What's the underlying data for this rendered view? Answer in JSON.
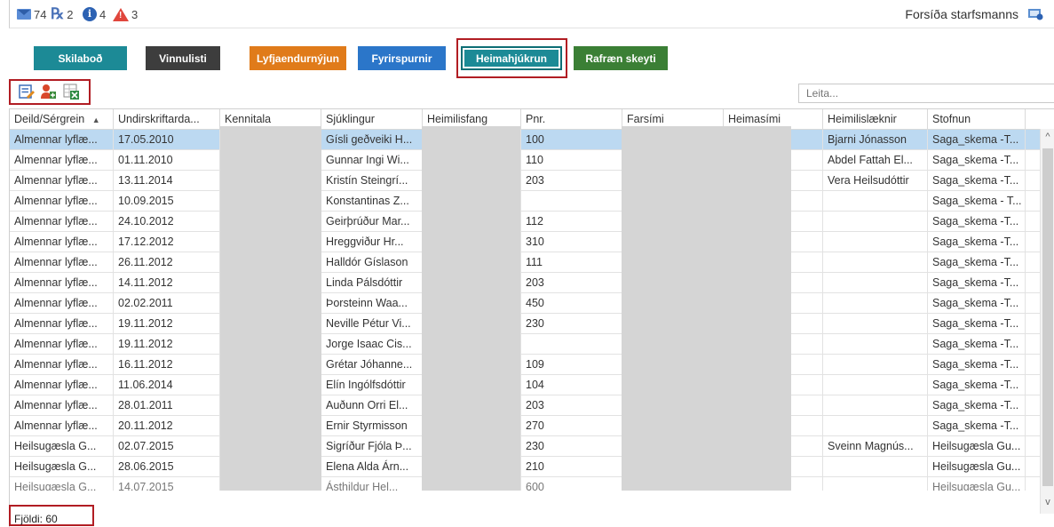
{
  "counters": [
    {
      "icon": "mail-icon",
      "value": "74"
    },
    {
      "icon": "prescription-icon",
      "value": "2"
    },
    {
      "icon": "info-icon",
      "value": "4"
    },
    {
      "icon": "warning-icon",
      "value": "3"
    }
  ],
  "header": {
    "home_link": "Forsíða starfsmanns"
  },
  "modules": [
    {
      "label": "Skilaboð",
      "color": "#1c8a96"
    },
    {
      "label": "Vinnulisti",
      "color": "#3d3d3d"
    },
    {
      "label": "Lyfjaendurnýjun",
      "color": "#e07b1a"
    },
    {
      "label": "Fyrirspurnir",
      "color": "#2b76c9"
    },
    {
      "label": "Heimahjúkrun",
      "color": "#1c8a96"
    },
    {
      "label": "Rafræn skeyti",
      "color": "#3b7f35"
    }
  ],
  "search": {
    "placeholder": "Leita..."
  },
  "table": {
    "columns": [
      "Deild/Sérgrein",
      "Undirskriftarda...",
      "Kennitala",
      "Sjúklingur",
      "Heimilisfang",
      "Pnr.",
      "Farsími",
      "Heimasími",
      "Heimilislæknir",
      "Stofnun"
    ],
    "sort_indicator": "▲",
    "rows": [
      [
        "Almennar lyflæ...",
        "17.05.2010",
        "",
        "Gísli geðveiki H...",
        "",
        "100",
        "",
        "",
        "Bjarni Jónasson",
        "Saga_skema -T..."
      ],
      [
        "Almennar lyflæ...",
        "01.11.2010",
        "",
        "Gunnar Ingi Wi...",
        "",
        "110",
        "",
        "",
        "Abdel Fattah El...",
        "Saga_skema -T..."
      ],
      [
        "Almennar lyflæ...",
        "13.11.2014",
        "",
        "Kristín Steingrí...",
        "",
        "203",
        "",
        "",
        "Vera Heilsudóttir",
        "Saga_skema -T..."
      ],
      [
        "Almennar lyflæ...",
        "10.09.2015",
        "",
        "Konstantinas Z...",
        "",
        "",
        "",
        "",
        "",
        "Saga_skema - T..."
      ],
      [
        "Almennar lyflæ...",
        "24.10.2012",
        "",
        "Geirþrúður Mar...",
        "",
        "112",
        "",
        "",
        "",
        "Saga_skema -T..."
      ],
      [
        "Almennar lyflæ...",
        "17.12.2012",
        "",
        "Hreggviður Hr...",
        "",
        "310",
        "",
        "",
        "",
        "Saga_skema -T..."
      ],
      [
        "Almennar lyflæ...",
        "26.11.2012",
        "",
        "Halldór Gíslason",
        "",
        "111",
        "",
        "",
        "",
        "Saga_skema -T..."
      ],
      [
        "Almennar lyflæ...",
        "14.11.2012",
        "",
        "Linda Pálsdóttir",
        "",
        "203",
        "",
        "",
        "",
        "Saga_skema -T..."
      ],
      [
        "Almennar lyflæ...",
        "02.02.2011",
        "",
        "Þorsteinn Waa...",
        "",
        "450",
        "",
        "",
        "",
        "Saga_skema -T..."
      ],
      [
        "Almennar lyflæ...",
        "19.11.2012",
        "",
        "Neville Pétur Vi...",
        "",
        "230",
        "",
        "",
        "",
        "Saga_skema -T..."
      ],
      [
        "Almennar lyflæ...",
        "19.11.2012",
        "",
        "Jorge Isaac Cis...",
        "",
        "",
        "",
        "",
        "",
        "Saga_skema -T..."
      ],
      [
        "Almennar lyflæ...",
        "16.11.2012",
        "",
        "Grétar Jóhanne...",
        "",
        "109",
        "",
        "",
        "",
        "Saga_skema -T..."
      ],
      [
        "Almennar lyflæ...",
        "11.06.2014",
        "",
        "Elín Ingólfsdóttir",
        "",
        "104",
        "",
        "",
        "",
        "Saga_skema -T..."
      ],
      [
        "Almennar lyflæ...",
        "28.01.2011",
        "",
        "Auðunn Orri El...",
        "",
        "203",
        "",
        "",
        "",
        "Saga_skema -T..."
      ],
      [
        "Almennar lyflæ...",
        "20.11.2012",
        "",
        "Ernir Styrmisson",
        "",
        "270",
        "",
        "",
        "",
        "Saga_skema -T..."
      ],
      [
        "Heilsugæsla G...",
        "02.07.2015",
        "",
        "Sigríður Fjóla Þ...",
        "",
        "230",
        "",
        "",
        "Sveinn Magnús...",
        "Heilsugæsla Gu..."
      ],
      [
        "Heilsugæsla G...",
        "28.06.2015",
        "",
        "Elena Alda Árn...",
        "",
        "210",
        "",
        "",
        "",
        "Heilsugæsla Gu..."
      ],
      [
        "Heilsugæsla G...",
        "14.07.2015",
        "",
        "Ásthildur Hel...",
        "",
        "600",
        "",
        "",
        "",
        "Heilsugæsla Gu..."
      ]
    ]
  },
  "footer": {
    "count": "Fjöldi: 60"
  },
  "colors": {
    "selected_row": "#bcd9f1",
    "highlight_box": "#b11d23"
  }
}
